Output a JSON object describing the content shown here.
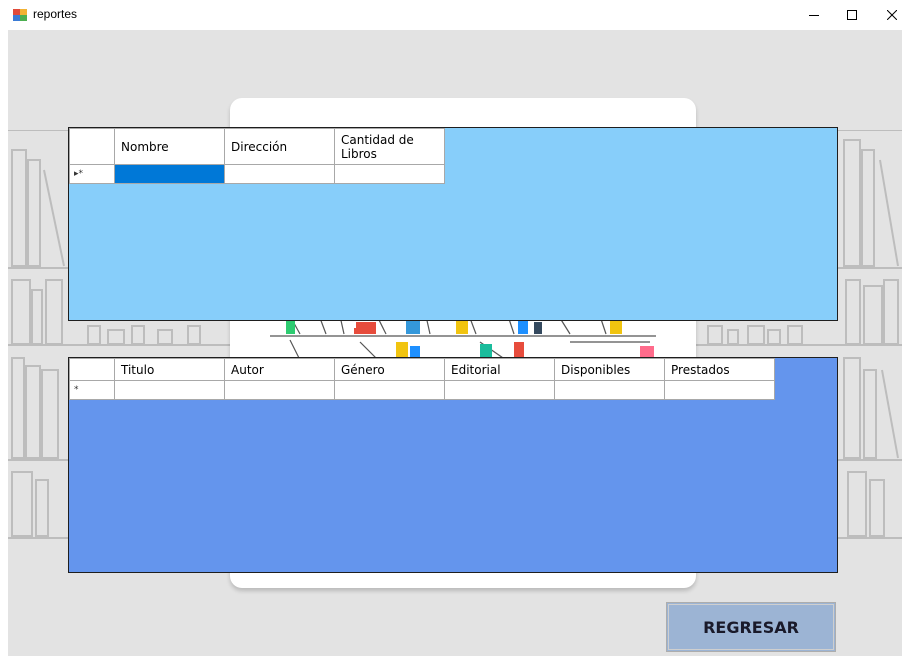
{
  "window": {
    "title": "reportes",
    "icon": "form-app-icon",
    "controls": [
      "minimize-icon",
      "maximize-icon",
      "close-icon"
    ]
  },
  "colors": {
    "top_grid_background": "#87cefa",
    "bottom_grid_background": "#6495ed",
    "selected_cell": "#0078d7",
    "button_background": "#9cb4d4"
  },
  "grid_bibliotecas": {
    "columns": [
      "Nombre",
      "Dirección",
      "Cantidad de Libros"
    ],
    "new_row_indicator": "▸*",
    "rows": [
      [
        "",
        "",
        ""
      ]
    ]
  },
  "grid_libros": {
    "columns": [
      "Titulo",
      "Autor",
      "Género",
      "Editorial",
      "Disponibles",
      "Prestados"
    ],
    "new_row_indicator": "*",
    "rows": [
      [
        "",
        "",
        "",
        "",
        "",
        ""
      ]
    ]
  },
  "buttons": {
    "regresar": "REGRESAR"
  }
}
